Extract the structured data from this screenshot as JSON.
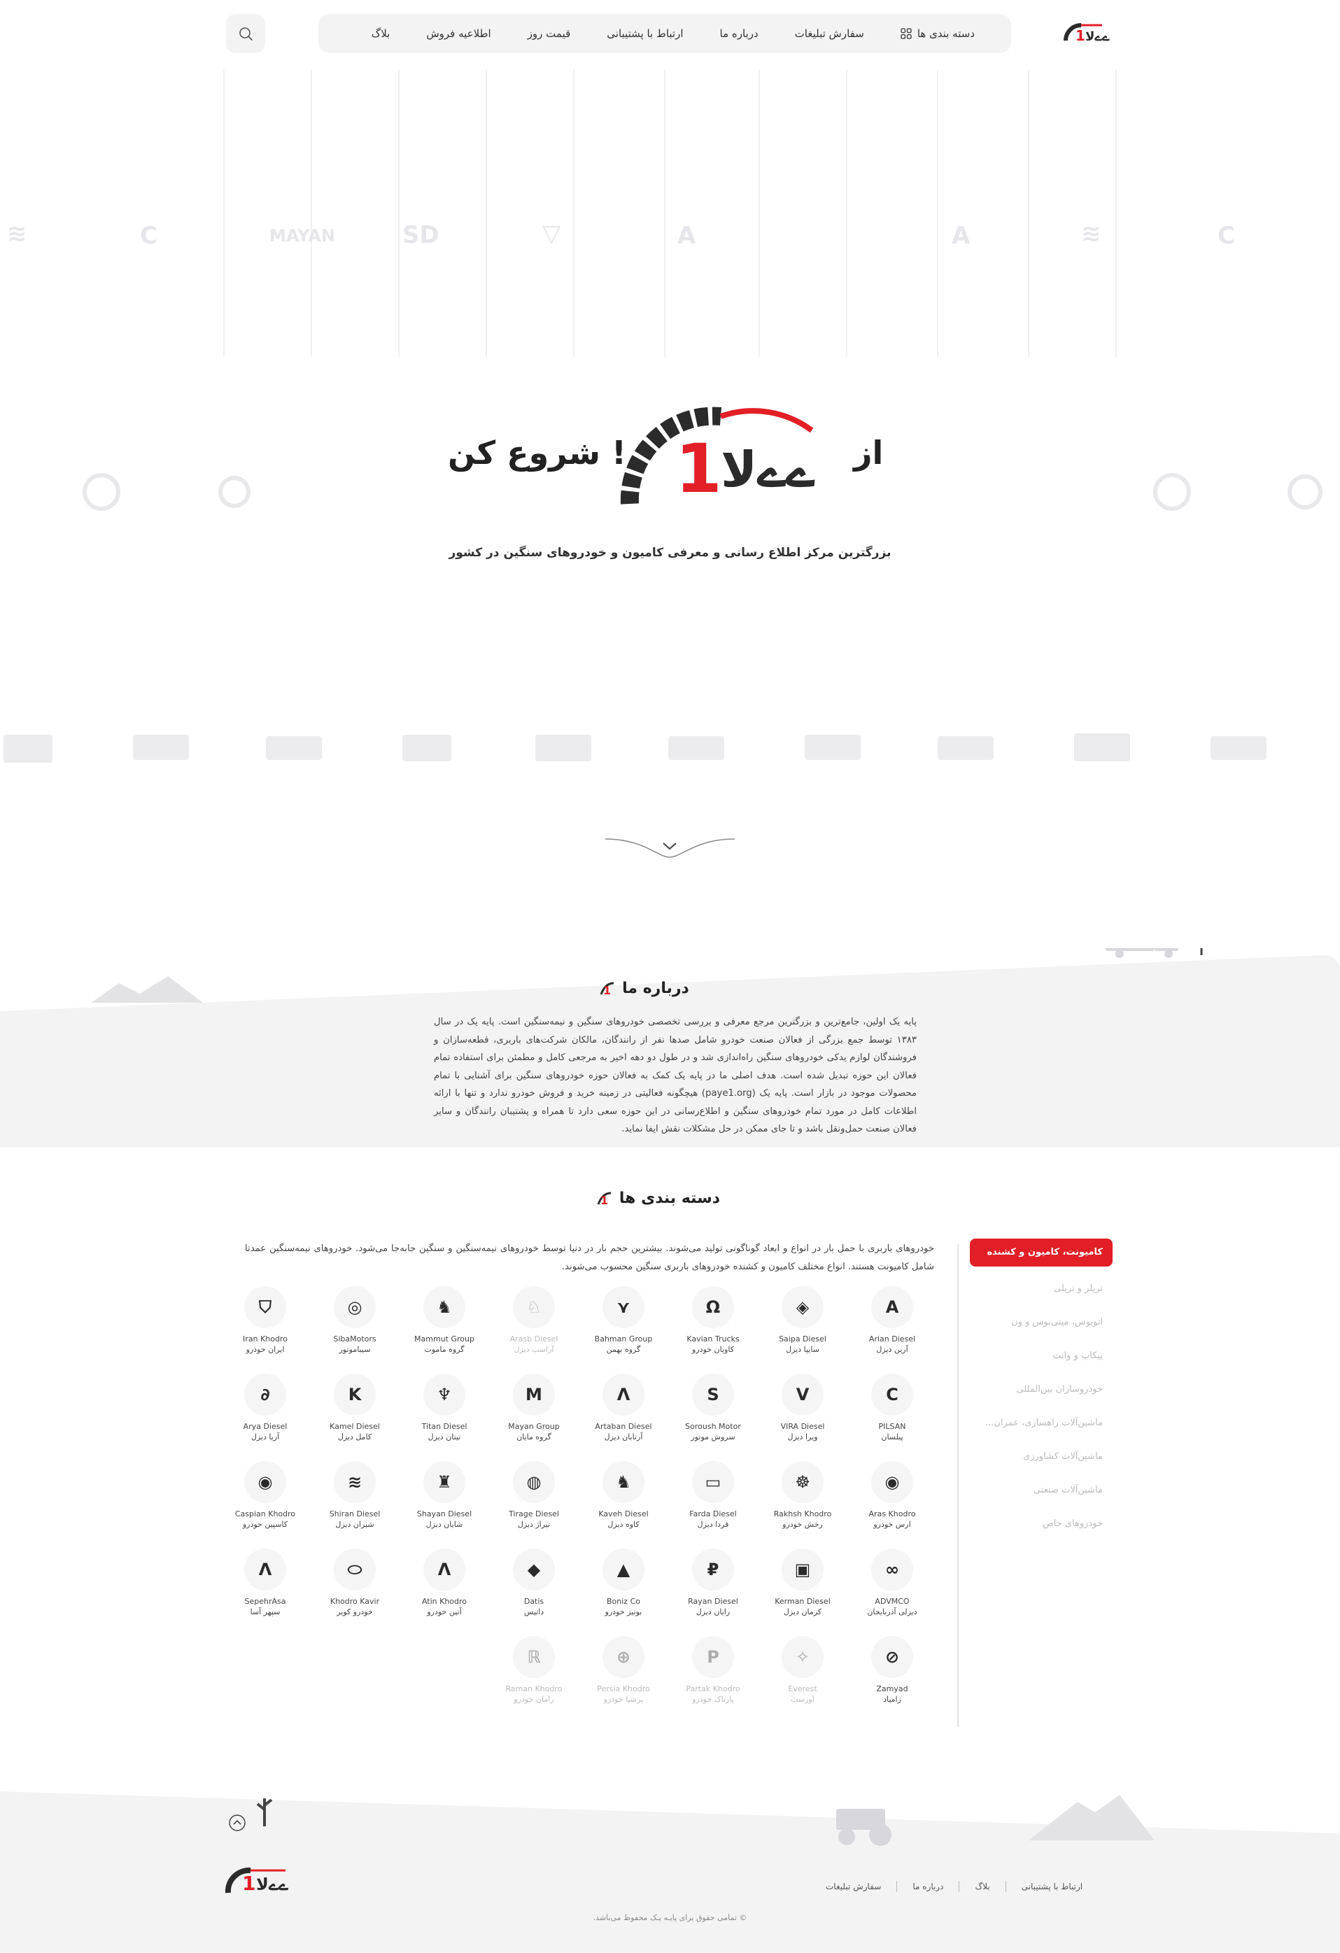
{
  "brand_colors": {
    "accent": "#e21f26",
    "dark": "#2b2b2b",
    "panel": "#f3f3f4"
  },
  "header": {
    "logo_icon": "paye1-logo",
    "nav": [
      {
        "label": "دسته بندی ها",
        "icon": "grid-icon"
      },
      {
        "label": "سفارش تبلیغات"
      },
      {
        "label": "درباره ما"
      },
      {
        "label": "ارتباط با پشتیبانی"
      },
      {
        "label": "قیمت روز"
      },
      {
        "label": "اطلاعیه فروش"
      },
      {
        "label": "بلاگ"
      }
    ],
    "search_icon": "search-icon"
  },
  "hero": {
    "word_left": "شروع کن !",
    "word_right": "از",
    "subtitle": "بزرگترین مرکز اطلاع رسانی و معرفی کامیون و خودروهای سنگین در کشور"
  },
  "about": {
    "title": "درباره ما",
    "text": "پایه یک اولین، جامع‌ترین و بزرگترین مرجع معرفی و بررسی تخصصی خودروهای سنگین و نیمه‌سنگین است. پایه یک در سال ۱۳۸۳ توسط جمع بزرگی از فعالان صنعت خودرو شامل صدها نفر از رانندگان، مالکان شرکت‌های باربری، قطعه‌سازان و فروشندگان لوازم یدکی خودروهای سنگین راه‌اندازی شد و در طول دو دهه اخیر به مرجعی کامل و مطمئن برای استفاده تمام فعالان این حوزه تبدیل شده است. هدف اصلی ما در پایه یک کمک به فعالان حوزه خودروهای سنگین برای آشنایی با تمام محصولات موجود در بازار است. پایه یک (paye1.org) هیچگونه فعالیتی در زمینه خرید و فروش خودرو ندارد و تنها با ارائه اطلاعات کامل در مورد تمام خودروهای سنگین و اطلاع‌رسانی در این حوزه سعی دارد تا همراه و پشتیبان رانندگان و سایر فعالان صنعت حمل‌ونقل باشد و تا جای ممکن در حل مشکلات نقش ایفا نماید."
  },
  "categories": {
    "title": "دسته بندی ها",
    "sidebar": [
      {
        "label": "کامیونت، کامیون و کشنده",
        "active": true
      },
      {
        "label": "تریلر و تریلی"
      },
      {
        "label": "اتوبوس، مینی‌بوس و ون"
      },
      {
        "label": "پیکاپ و وانت"
      },
      {
        "label": "خودروسازان بین‌المللی"
      },
      {
        "label": "ماشین‌آلات راهسازی، عمران..."
      },
      {
        "label": "ماشین‌آلات کشاورزی"
      },
      {
        "label": "ماشین‌آلات صنعتی"
      },
      {
        "label": "خودروهای خاص"
      }
    ],
    "description": "خودروهای باربری با حمل بار در انواع و ابعاد گوناگونی تولید می‌شوند. بیشترین حجم بار در دنیا توسط خودروهای نیمه‌سنگین و سنگین جابه‌جا می‌شود. خودروهای نیمه‌سنگین عمدتا شامل کامیونت هستند. انواع مختلف کامیون و کشنده خودروهای باربری سنگین محسوب می‌شوند.",
    "brands": [
      {
        "en": "Arian Diesel",
        "fa": "آرین دیزل",
        "icon": "arian-logo-icon"
      },
      {
        "en": "Saipa Diesel",
        "fa": "سایپا دیزل",
        "icon": "saipa-logo-icon"
      },
      {
        "en": "Kavian Trucks",
        "fa": "کاویان خودرو",
        "icon": "kavian-logo-icon"
      },
      {
        "en": "Bahman Group",
        "fa": "گروه بهمن",
        "icon": "bahman-logo-icon"
      },
      {
        "en": "Arasb Diesel",
        "fa": "آراسب دیزل",
        "icon": "arasb-logo-icon",
        "dim": true
      },
      {
        "en": "Mammut Group",
        "fa": "گروه ماموت",
        "icon": "mammut-logo-icon"
      },
      {
        "en": "SibaMotors",
        "fa": "سیباموتور",
        "icon": "siba-logo-icon"
      },
      {
        "en": "Iran Khodro",
        "fa": "ایران خودرو",
        "icon": "iran-khodro-logo-icon"
      },
      {
        "en": "PILSAN",
        "fa": "پیلسان",
        "icon": "pilsan-logo-icon"
      },
      {
        "en": "VIRA Diesel",
        "fa": "ویرا دیزل",
        "icon": "vira-logo-icon"
      },
      {
        "en": "Soroush Motor",
        "fa": "سروش موتور",
        "icon": "soroush-logo-icon"
      },
      {
        "en": "Artaban Diesel",
        "fa": "آرتابان دیزل",
        "icon": "artaban-logo-icon"
      },
      {
        "en": "Mayan Group",
        "fa": "گروه مایان",
        "icon": "mayan-logo-icon"
      },
      {
        "en": "Titan Diesel",
        "fa": "تیتان دیزل",
        "icon": "titan-logo-icon"
      },
      {
        "en": "Kamel Diesel",
        "fa": "کامل دیزل",
        "icon": "kamel-logo-icon"
      },
      {
        "en": "Arya Diesel",
        "fa": "آریا دیزل",
        "icon": "arya-logo-icon"
      },
      {
        "en": "Aras Khodro",
        "fa": "ارس خودرو",
        "icon": "amico-logo-icon"
      },
      {
        "en": "Rakhsh Khodro",
        "fa": "رخش خودرو",
        "icon": "rakhsh-logo-icon"
      },
      {
        "en": "Farda Diesel",
        "fa": "فردا دیزل",
        "icon": "farda-logo-icon"
      },
      {
        "en": "Kaveh Diesel",
        "fa": "کاوه دیزل",
        "icon": "kaveh-logo-icon"
      },
      {
        "en": "Tirage Diesel",
        "fa": "تیراژ دیزل",
        "icon": "tirage-logo-icon"
      },
      {
        "en": "Shayan Diesel",
        "fa": "شایان دیزل",
        "icon": "shayan-logo-icon"
      },
      {
        "en": "Shiran Diesel",
        "fa": "شیران دیزل",
        "icon": "shiran-logo-icon"
      },
      {
        "en": "Caspian Khodro",
        "fa": "کاسپین خودرو",
        "icon": "caspian-logo-icon"
      },
      {
        "en": "ADVMCO",
        "fa": "دیزلی آذربایجان",
        "icon": "advmco-logo-icon"
      },
      {
        "en": "Kerman Diesel",
        "fa": "کرمان دیزل",
        "icon": "kerman-logo-icon"
      },
      {
        "en": "Rayan Diesel",
        "fa": "رایان دیزل",
        "icon": "rayan-logo-icon"
      },
      {
        "en": "Boniz Co",
        "fa": "بونیز خودرو",
        "icon": "boniz-logo-icon"
      },
      {
        "en": "Datis",
        "fa": "داتیس",
        "icon": "datis-logo-icon"
      },
      {
        "en": "Atin Khodro",
        "fa": "آتین خودرو",
        "icon": "atin-logo-icon"
      },
      {
        "en": "Khodro Kavir",
        "fa": "خودرو کویر",
        "icon": "kavir-logo-icon"
      },
      {
        "en": "SepehrAsa",
        "fa": "سپهر آسا",
        "icon": "sepehrasa-logo-icon"
      },
      {
        "en": "Zamyad",
        "fa": "زامیاد",
        "icon": "zamyad-logo-icon"
      },
      {
        "en": "Everest",
        "fa": "اورست",
        "icon": "everest-logo-icon",
        "dim": true
      },
      {
        "en": "Partak Khodro",
        "fa": "پارتاک خودرو",
        "icon": "partak-logo-icon",
        "dim": true
      },
      {
        "en": "Persia Khodro",
        "fa": "پرشیا خودرو",
        "icon": "persia-logo-icon",
        "dim": true
      },
      {
        "en": "Raman Khodro",
        "fa": "رامان خودرو",
        "icon": "raman-logo-icon",
        "dim": true
      }
    ]
  },
  "footer": {
    "links": [
      "سفارش تبلیغات",
      "درباره ما",
      "بلاگ",
      "ارتباط با پشتیبانی"
    ],
    "copyright": "© تمامی حقوق برای پایـه یـک محفوظ می‌باشد.",
    "to_top_icon": "chevron-up-icon"
  }
}
